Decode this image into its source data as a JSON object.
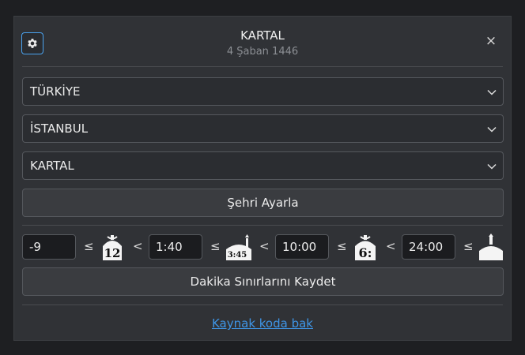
{
  "header": {
    "title": "KARTAL",
    "hijri_date": "4 Şaban 1446",
    "settings_icon": "gear-icon",
    "close_label": "×"
  },
  "location": {
    "country": "TÜRKİYE",
    "province": "İSTANBUL",
    "district": "KARTAL"
  },
  "buttons": {
    "set_city": "Şehri Ayarla",
    "save_limits": "Dakika Sınırlarını Kaydet"
  },
  "limits": {
    "values": [
      "-9",
      "1:40",
      "10:00",
      "24:00"
    ],
    "operators": [
      "≤",
      "<",
      "≤",
      "<",
      "≤",
      "<",
      "≤"
    ],
    "clock_labels": [
      "12",
      "3:45",
      "6:"
    ]
  },
  "footer": {
    "source_link": "Kaynak koda bak"
  },
  "colors": {
    "accent": "#4aa3f0",
    "link": "#3e95e6",
    "panel": "#303236"
  }
}
